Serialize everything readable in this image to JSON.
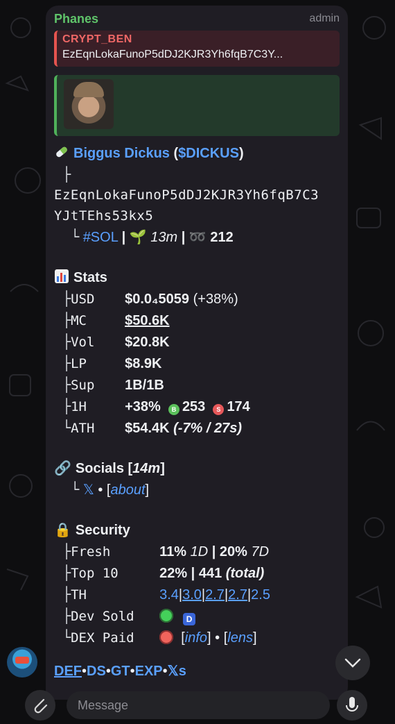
{
  "header": {
    "sender": "Phanes",
    "role": "admin"
  },
  "reply": {
    "name": "CRYPT_BEN",
    "text": "EzEqnLokaFunoP5dDJ2KJR3Yh6fqB7C3Y..."
  },
  "token": {
    "name": "Biggus Dickus",
    "open_paren": " (",
    "ticker": "$DICKUS",
    "close_paren": ")",
    "address_line1": "EzEqnLokaFunoP5dDJ2KJR3Yh6fqB7C3",
    "address_line2": "YJtTEhs53kx5",
    "chain": "#SOL",
    "age": "13m",
    "views": "212"
  },
  "stats": {
    "title": "Stats",
    "usd_label": "USD",
    "usd_value": "$0.0₄5059",
    "usd_change": " (+38%)",
    "mc_label": "MC",
    "mc_value": "$50.6K",
    "vol_label": "Vol",
    "vol_value": "$20.8K",
    "lp_label": "LP",
    "lp_value": "$8.9K",
    "sup_label": "Sup",
    "sup_value": "1B/1B",
    "h1_label": "1H",
    "h1_value": "+38%",
    "buys": "253",
    "sells": "174",
    "buy_badge": "B",
    "sell_badge": "S",
    "ath_label": "ATH",
    "ath_value": "$54.4K",
    "ath_extra": " (-7% / 27s)"
  },
  "socials": {
    "title": "Socials",
    "age": "14m",
    "x": "𝕏",
    "about": "about"
  },
  "security": {
    "title": "Security",
    "fresh_label": "Fresh",
    "fresh_1d": "11%",
    "fresh_1d_unit": "1D",
    "fresh_7d": "20%",
    "fresh_7d_unit": "7D",
    "top10_label": "Top 10",
    "top10_pct": "22%",
    "top10_total": "441",
    "top10_total_label": "(total)",
    "th_label": "TH",
    "th_values": [
      "3.4",
      "3.0",
      "2.7",
      "2.7",
      "2.5"
    ],
    "dev_label": "Dev Sold",
    "dev_badge": "D",
    "dex_label": "DEX Paid",
    "dex_info": "info",
    "dex_lens": "lens"
  },
  "footer_links": [
    "DEF",
    "DS",
    "GT",
    "EXP",
    "𝕏s"
  ],
  "composer": {
    "placeholder": "Message"
  },
  "colors": {
    "accent_blue": "#5aa0ff",
    "sender_green": "#5fc46a",
    "reply_red": "#ef6766"
  }
}
